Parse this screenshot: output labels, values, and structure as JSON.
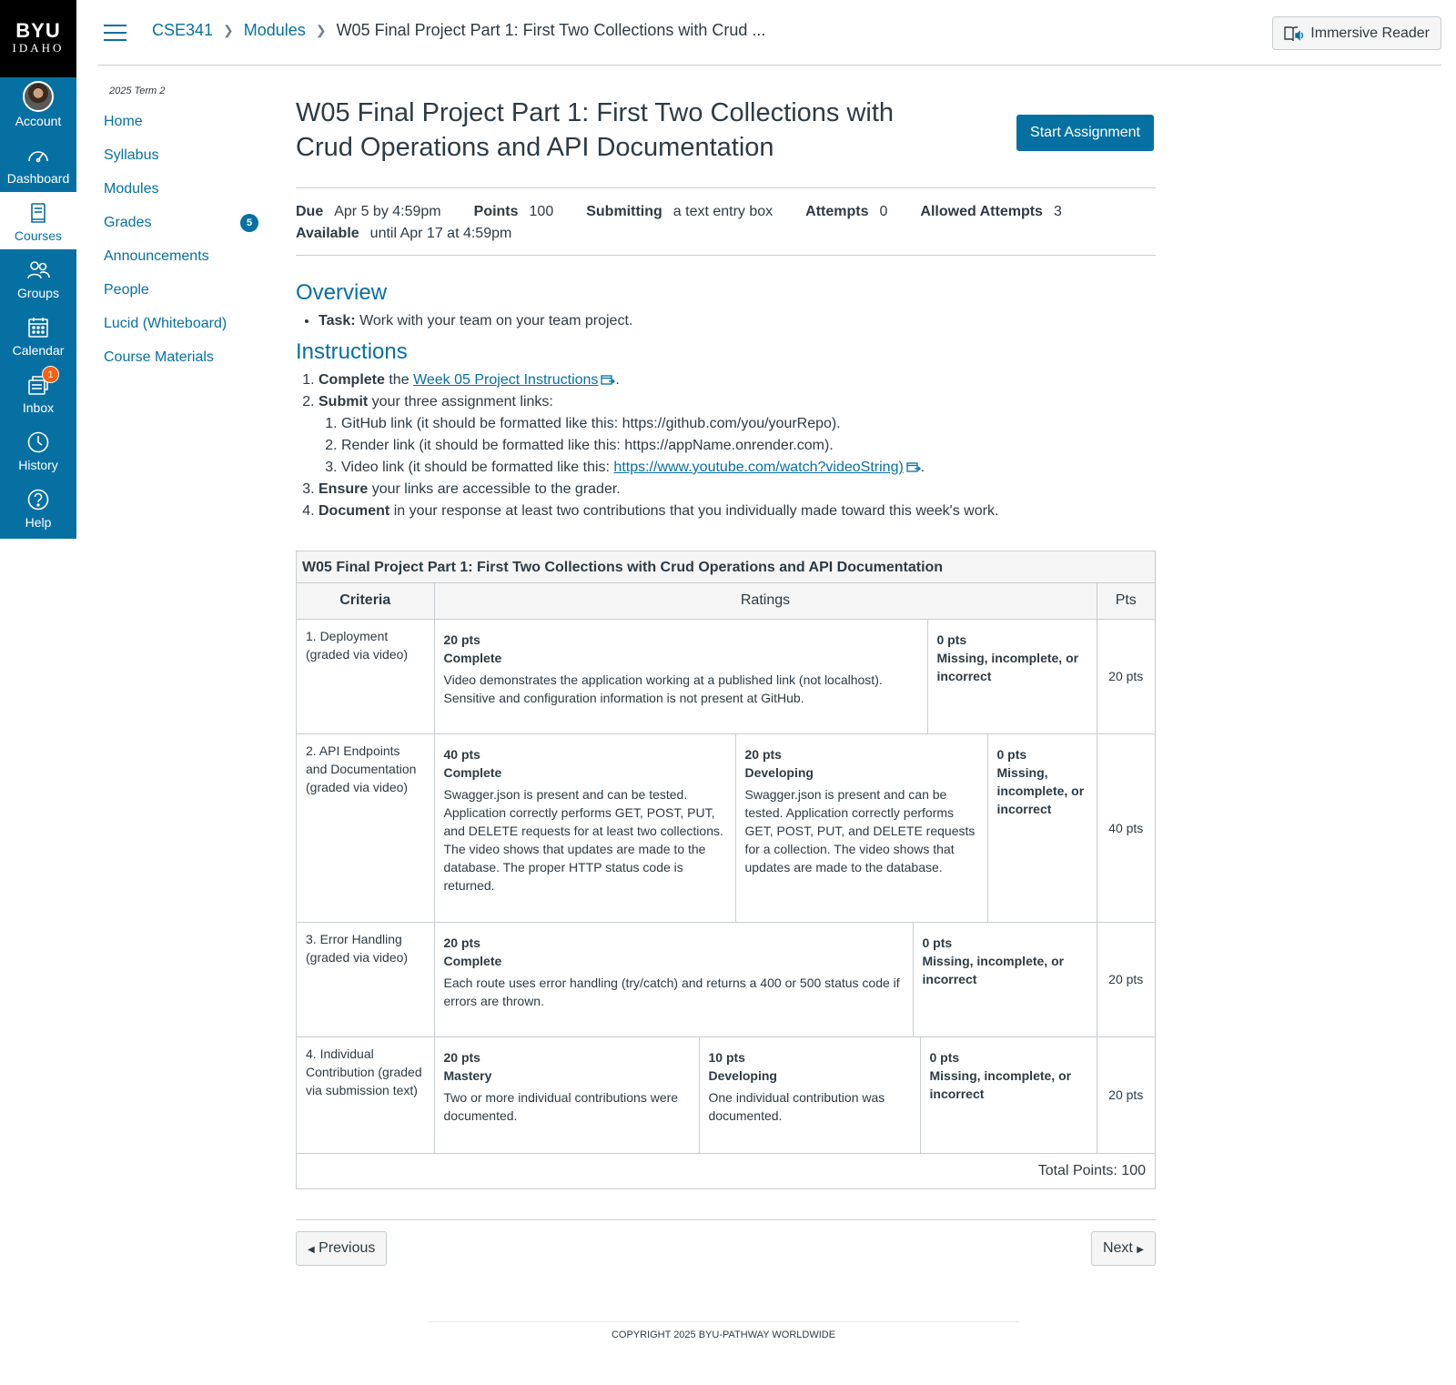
{
  "global_nav": {
    "logo_top": "BYU",
    "logo_bottom": "IDAHO",
    "items": [
      {
        "label": "Account"
      },
      {
        "label": "Dashboard"
      },
      {
        "label": "Courses"
      },
      {
        "label": "Groups"
      },
      {
        "label": "Calendar"
      },
      {
        "label": "Inbox",
        "badge": "1"
      },
      {
        "label": "History"
      },
      {
        "label": "Help"
      }
    ]
  },
  "header": {
    "breadcrumbs": [
      "CSE341",
      "Modules",
      "W05 Final Project Part 1: First Two Collections with Crud ..."
    ],
    "immersive_reader": "Immersive Reader"
  },
  "course_nav": {
    "term": "2025 Term 2",
    "items": [
      {
        "label": "Home"
      },
      {
        "label": "Syllabus"
      },
      {
        "label": "Modules"
      },
      {
        "label": "Grades",
        "badge": "5"
      },
      {
        "label": "Announcements"
      },
      {
        "label": "People"
      },
      {
        "label": "Lucid (Whiteboard)"
      },
      {
        "label": "Course Materials"
      }
    ]
  },
  "assignment": {
    "title": "W05 Final Project Part 1: First Two Collections with Crud Operations and API Documentation",
    "start_button": "Start Assignment",
    "details": {
      "due_label": "Due",
      "due": "Apr 5 by 4:59pm",
      "points_label": "Points",
      "points": "100",
      "submitting_label": "Submitting",
      "submitting": "a text entry box",
      "attempts_label": "Attempts",
      "attempts": "0",
      "allowed_label": "Allowed Attempts",
      "allowed": "3",
      "available_label": "Available",
      "available": "until Apr 17 at 4:59pm"
    },
    "overview_heading": "Overview",
    "overview_task_label": "Task:",
    "overview_task": "Work with your team on your team project.",
    "instructions_heading": "Instructions",
    "instructions": {
      "i1_bold": "Complete",
      "i1_pre": "the",
      "i1_link": "Week 05 Project Instructions",
      "i2_bold": "Submit",
      "i2_text": "your three assignment links:",
      "sub1": "GitHub link (it should be formatted like this: https://github.com/you/yourRepo).",
      "sub2": "Render link (it should be formatted like this: https://appName.onrender.com).",
      "sub3_pre": "Video link (it should be formatted like this:",
      "sub3_link": "https://www.youtube.com/watch?videoString)",
      "i3_bold": "Ensure",
      "i3_text": "your links are accessible to the grader.",
      "i4_bold": "Document",
      "i4_text": "in your response at least two contributions that you individually made toward this week's work."
    }
  },
  "rubric": {
    "title": "W05 Final Project Part 1: First Two Collections with Crud Operations and API Documentation",
    "headers": {
      "criteria": "Criteria",
      "ratings": "Ratings",
      "pts": "Pts"
    },
    "rows": [
      {
        "criterion": "1. Deployment (graded via video)",
        "pts": "20 pts",
        "ratings": [
          {
            "pts": "20 pts",
            "title": "Complete",
            "desc": "Video demonstrates the application working at a published link (not localhost). Sensitive and configuration information is not present at GitHub."
          },
          {
            "pts": "0 pts",
            "title": "Missing, incomplete, or incorrect",
            "desc": ""
          }
        ]
      },
      {
        "criterion": "2. API Endpoints and Documentation (graded via video)",
        "pts": "40 pts",
        "ratings": [
          {
            "pts": "40 pts",
            "title": "Complete",
            "desc": "Swagger.json is present and can be tested. Application correctly performs GET, POST, PUT, and DELETE requests for at least two collections. The video shows that updates are made to the database. The proper HTTP status code is returned."
          },
          {
            "pts": "20 pts",
            "title": "Developing",
            "desc": "Swagger.json is present and can be tested. Application correctly performs GET, POST, PUT, and DELETE requests for a collection. The video shows that updates are made to the database."
          },
          {
            "pts": "0 pts",
            "title": "Missing, incomplete, or incorrect",
            "desc": ""
          }
        ]
      },
      {
        "criterion": "3. Error Handling (graded via video)",
        "pts": "20 pts",
        "ratings": [
          {
            "pts": "20 pts",
            "title": "Complete",
            "desc": "Each route uses error handling (try/catch) and returns a 400 or 500 status code if errors are thrown."
          },
          {
            "pts": "0 pts",
            "title": "Missing, incomplete, or incorrect",
            "desc": ""
          }
        ]
      },
      {
        "criterion": "4. Individual Contribution (graded via submission text)",
        "pts": "20 pts",
        "ratings": [
          {
            "pts": "20 pts",
            "title": "Mastery",
            "desc": "Two or more individual contributions were documented."
          },
          {
            "pts": "10 pts",
            "title": "Developing",
            "desc": "One individual contribution was documented."
          },
          {
            "pts": "0 pts",
            "title": "Missing, incomplete, or incorrect",
            "desc": ""
          }
        ]
      }
    ],
    "total": "Total Points: 100"
  },
  "pager": {
    "previous": "Previous",
    "next": "Next"
  },
  "footer": {
    "copyright": "COPYRIGHT 2025 BYU-PATHWAY WORLDWIDE"
  },
  "colors": {
    "brand": "#0770a3",
    "badge_orange": "#fc5e13"
  }
}
